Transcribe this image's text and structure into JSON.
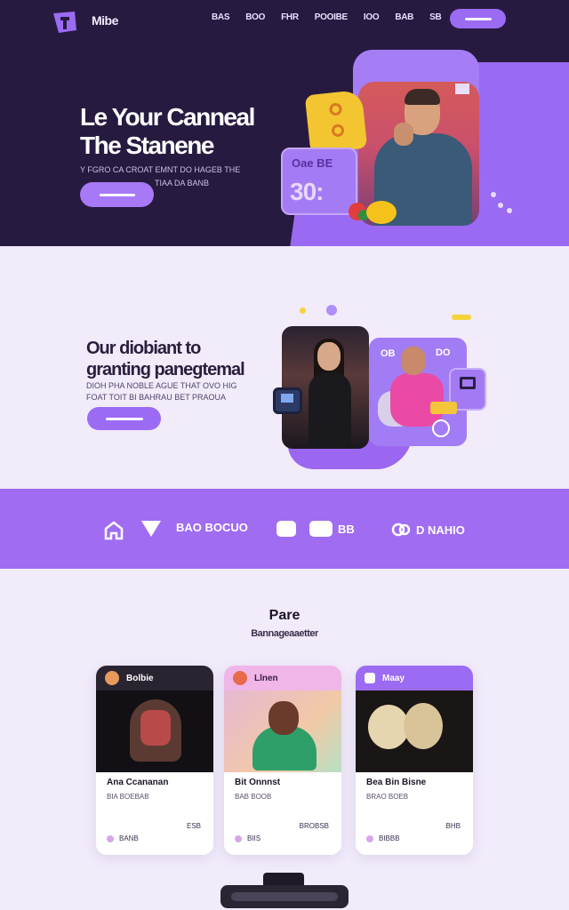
{
  "header": {
    "brand": "Mibe",
    "nav": [
      "BAS",
      "BOO",
      "FHR",
      "POOIBE",
      "IOO",
      "BAB",
      "SB"
    ],
    "nav_button": ""
  },
  "hero": {
    "title_line1": "Le Your Canneal",
    "title_line2": "The Stanene",
    "subtitle_line1": "Y FGRO CA CROAT EMNT DO HAGEB THE",
    "subtitle_line2": "TIAA DA BANB",
    "card_top": "Oae BE",
    "card_big": "30:"
  },
  "section2": {
    "title_line1": "Our diobiant to",
    "title_line2": "granting panegtemal",
    "subtitle_line1": "DIOH PHA NOBLE AGUE THAT OVO HIG",
    "subtitle_line2": "FOAT TOIT BI BAHRAU BET PRAOUA",
    "photo_tag1": "OB",
    "photo_tag2": "DO"
  },
  "logos": {
    "items": [
      {
        "icon": "house-icon",
        "label": ""
      },
      {
        "icon": "triangle-icon",
        "label": ""
      },
      {
        "icon": "text-logo",
        "label": "BAO BOCUO"
      },
      {
        "icon": "box-icon",
        "label": ""
      },
      {
        "icon": "pill-icon",
        "label": "BB"
      },
      {
        "icon": "circle-icon",
        "label": "D NAHIO"
      }
    ]
  },
  "pricing": {
    "title": "Pare",
    "subtitle": "Bannageaaetter",
    "cards": [
      {
        "header": "Bolbie",
        "name": "Ana Ccananan",
        "desc": "BIA BOEBAB",
        "price": "ESB",
        "meta": "BANB"
      },
      {
        "header": "Llnen",
        "name": "Bit Onnnst",
        "desc": "BAB BOOB",
        "price": "BROBSB",
        "meta": "BIIS"
      },
      {
        "header": "Maay",
        "name": "Bea Bin Bisne",
        "desc": "BRAO BOEB",
        "price": "BHB",
        "meta": "BIBBB"
      }
    ]
  },
  "colors": {
    "hero_bg": "#271a40",
    "accent": "#9b6bf4",
    "page_bg": "#f1ebfa",
    "strip_bg": "#a06cf2"
  }
}
